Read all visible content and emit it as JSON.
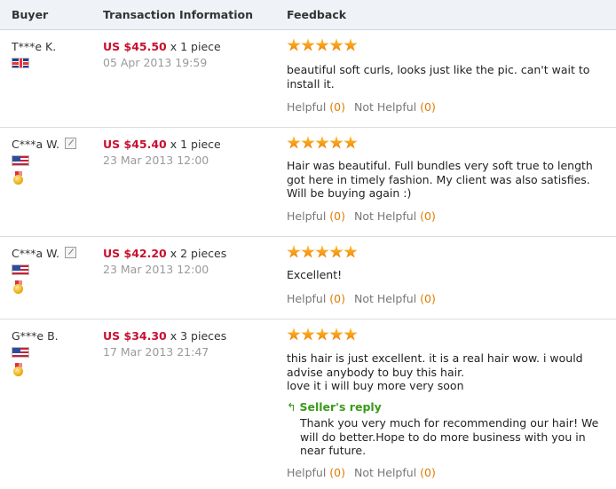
{
  "headers": {
    "buyer": "Buyer",
    "transaction": "Transaction Information",
    "feedback": "Feedback"
  },
  "helpful_label": "Helpful",
  "not_helpful_label": "Not Helpful",
  "reviews": [
    {
      "buyer": "T***e K.",
      "flag": "flag-uk-icon",
      "price": "US $45.50",
      "quantity": "x 1 piece",
      "date": "05 Apr 2013 19:59",
      "rating": 5,
      "text": "beautiful soft curls, looks just like the pic. can't wait to install it.",
      "helpful": "(0)",
      "not_helpful": "(0)"
    },
    {
      "buyer": "C***a W.",
      "flag": "flag-us-icon",
      "price": "US $45.40",
      "quantity": "x 1 piece",
      "date": "23 Mar 2013 12:00",
      "rating": 5,
      "text": "Hair was beautiful. Full bundles very soft true to length got here in timely fashion. My client was also satisfies. Will be buying again :)",
      "helpful": "(0)",
      "not_helpful": "(0)"
    },
    {
      "buyer": "C***a W.",
      "flag": "flag-us-icon",
      "price": "US $42.20",
      "quantity": "x 2 pieces",
      "date": "23 Mar 2013 12:00",
      "rating": 5,
      "text": "Excellent!",
      "helpful": "(0)",
      "not_helpful": "(0)"
    },
    {
      "buyer": "G***e B.",
      "flag": "flag-us-icon",
      "price": "US $34.30",
      "quantity": "x 3 pieces",
      "date": "17 Mar 2013 21:47",
      "rating": 5,
      "text_lines": [
        "this hair is just excellent. it is a real hair wow. i would advise anybody to buy this hair.",
        "love it i will buy more very soon"
      ],
      "reply_title": "Seller's reply",
      "reply_text": "Thank you very much for recommending our hair! We will do better.Hope to do more business with you in near future.",
      "helpful": "(0)",
      "not_helpful": "(0)"
    }
  ],
  "colors": {
    "price": "#c8102e",
    "date": "#9a9a9a",
    "reply": "#3a9a1a",
    "count": "#e07b00",
    "header_bg": "#eff3f8"
  }
}
